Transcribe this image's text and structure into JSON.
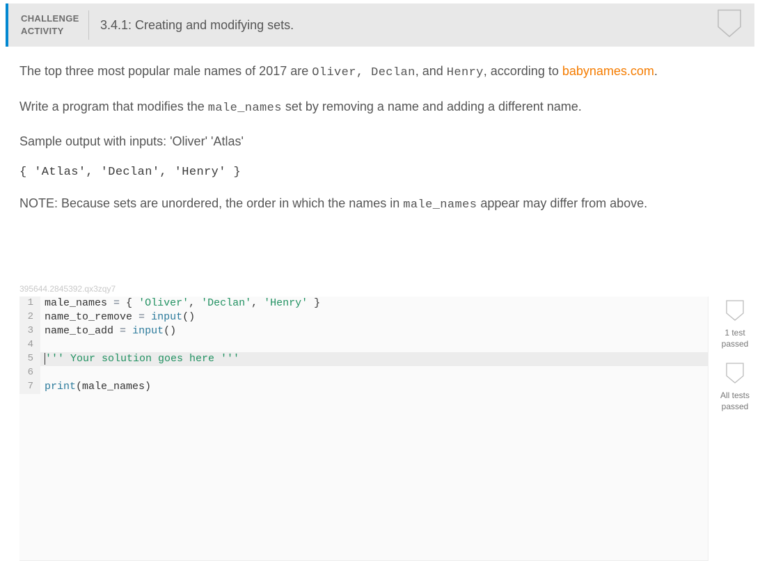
{
  "header": {
    "label_line1": "CHALLENGE",
    "label_line2": "ACTIVITY",
    "title": "3.4.1: Creating and modifying sets."
  },
  "description": {
    "p1_pre": "The top three most popular male names of 2017 are ",
    "p1_name1": "Oliver",
    "p1_mid1": ", ",
    "p1_name2": "Declan",
    "p1_mid2": ", and ",
    "p1_name3": "Henry",
    "p1_post": ", according to ",
    "p1_link": "babynames.com",
    "p1_end": ".",
    "p2_pre": "Write a program that modifies the ",
    "p2_code": "male_names",
    "p2_post": " set by removing a name and adding a different name.",
    "p3": "Sample output with inputs: 'Oliver' 'Atlas'",
    "sample_output": "{ 'Atlas', 'Declan', 'Henry' }",
    "p4_pre": "NOTE: Because sets are unordered, the order in which the names in ",
    "p4_code": "male_names",
    "p4_post": " appear may differ from above."
  },
  "watermark": "395644.2845392.qx3zqy7",
  "code": {
    "lines": [
      "1",
      "2",
      "3",
      "4",
      "5",
      "6",
      "7"
    ],
    "l1": {
      "a": "male_names ",
      "b": "=",
      "c": " { ",
      "d": "'Oliver'",
      "e": ", ",
      "f": "'Declan'",
      "g": ", ",
      "h": "'Henry'",
      "i": " }"
    },
    "l2": {
      "a": "name_to_remove ",
      "b": "=",
      "c": " ",
      "d": "input",
      "e": "()"
    },
    "l3": {
      "a": "name_to_add ",
      "b": "=",
      "c": " ",
      "d": "input",
      "e": "()"
    },
    "l5": {
      "a": "''' Your solution goes here '''"
    },
    "l7": {
      "a": "print",
      "b": "(male_names)"
    }
  },
  "badges": {
    "b1_line1": "1 test",
    "b1_line2": "passed",
    "b2_line1": "All tests",
    "b2_line2": "passed"
  }
}
